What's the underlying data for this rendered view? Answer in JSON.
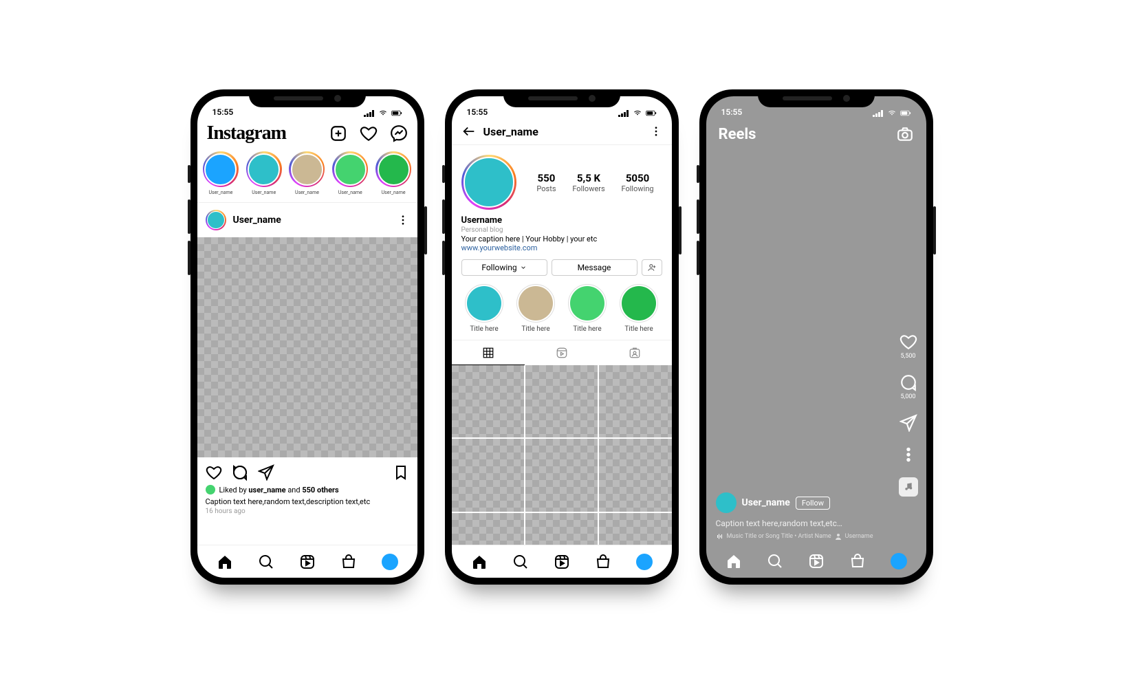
{
  "status": {
    "time": "15:55"
  },
  "feed": {
    "logo": "Instagram",
    "stories": [
      {
        "name": "User_name",
        "color": "#1ba4ff"
      },
      {
        "name": "User_name",
        "color": "#2ebfc9"
      },
      {
        "name": "User_name",
        "color": "#cbb894"
      },
      {
        "name": "User_name",
        "color": "#44d36f"
      },
      {
        "name": "User_name",
        "color": "#24b84c"
      }
    ],
    "post": {
      "username": "User_name",
      "liked_prefix": "Liked by ",
      "liked_by": "user_name",
      "liked_mid": " and ",
      "liked_others": "550 others",
      "caption": "Caption text here,random text,description text,etc",
      "time": "16 hours ago"
    }
  },
  "profile": {
    "title": "User_name",
    "stats": {
      "posts": {
        "num": "550",
        "label": "Posts"
      },
      "followers": {
        "num": "5,5 K",
        "label": "Followers"
      },
      "following": {
        "num": "5050",
        "label": "Following"
      }
    },
    "bio": {
      "name": "Username",
      "category": "Personal blog",
      "text": "Your caption here | Your Hobby | your etc",
      "link": "www.yourwebsite.com"
    },
    "buttons": {
      "following": "Following",
      "message": "Message"
    },
    "highlights": [
      {
        "label": "Title here",
        "color": "#2ebfc9"
      },
      {
        "label": "Title here",
        "color": "#cbb894"
      },
      {
        "label": "Title here",
        "color": "#44d36f"
      },
      {
        "label": "Title here",
        "color": "#24b84c"
      }
    ]
  },
  "reels": {
    "title": "Reels",
    "likes": "5,500",
    "comments": "5,000",
    "username": "User_name",
    "follow": "Follow",
    "caption": "Caption text here,random text,etc…",
    "music": "Music Title or Song Title • Artist Name",
    "music_user": "Username"
  }
}
